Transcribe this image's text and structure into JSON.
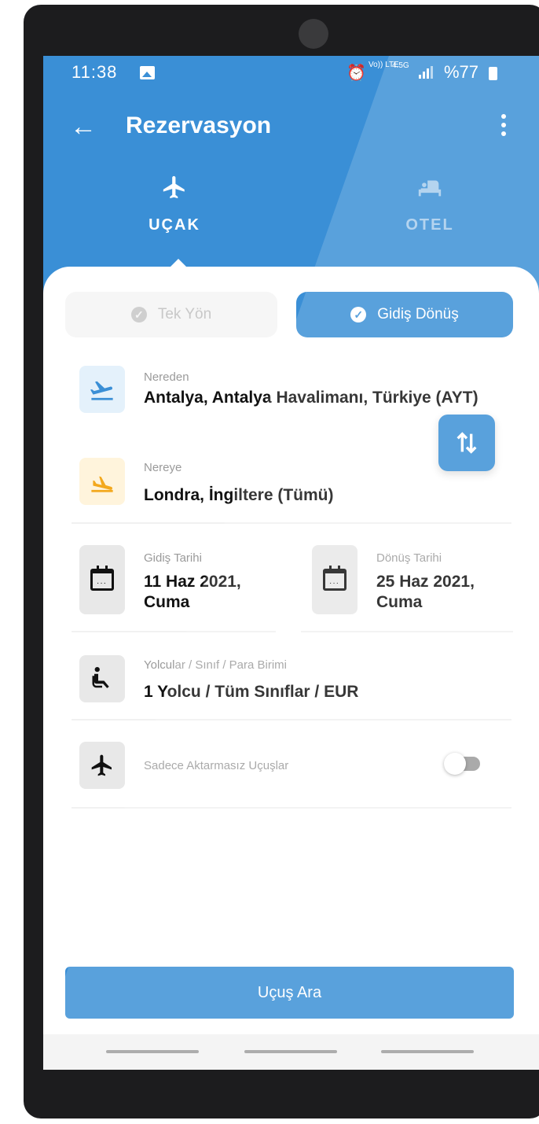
{
  "status_bar": {
    "time": "11:38",
    "network_top": "Vo)) LTE",
    "network_mid": "4.5G",
    "battery": "%77"
  },
  "toolbar": {
    "back_icon": "arrow-left-icon",
    "title": "Rezervasyon",
    "more_icon": "more-vertical-icon"
  },
  "tabs": [
    {
      "label": "UÇAK",
      "icon": "airplane-icon",
      "active": true
    },
    {
      "label": "OTEL",
      "icon": "bed-icon",
      "active": false
    }
  ],
  "trip_type": {
    "one_way": "Tek Yön",
    "round_trip": "Gidiş Dönüş",
    "selected": "round_trip"
  },
  "from": {
    "label": "Nereden",
    "value": "Antalya, Antalya Havalimanı, Türkiye (AYT)",
    "icon": "takeoff-icon"
  },
  "to": {
    "label": "Nereye",
    "value": "Londra, İngiltere (Tümü)",
    "icon": "landing-icon"
  },
  "swap_icon": "swap-vertical-icon",
  "departure": {
    "label": "Gidiş Tarihi",
    "date": "11 Haz 2021,",
    "day": "Cuma",
    "icon": "calendar-icon"
  },
  "return": {
    "label": "Dönüş Tarihi",
    "date": "25 Haz 2021,",
    "day": "Cuma",
    "icon": "calendar-icon"
  },
  "passengers": {
    "label": "Yolcular / Sınıf / Para Birimi",
    "value": "1 Yolcu / Tüm Sınıflar / EUR",
    "icon": "seat-icon"
  },
  "direct_only": {
    "label": "Sadece Aktarmasız Uçuşlar",
    "enabled": false,
    "icon": "airplane-icon"
  },
  "search_button": "Uçuş Ara",
  "colors": {
    "brand": "#3a8fd6",
    "takeoff_bg": "#e4f1fb",
    "landing_bg": "#fff4dc",
    "landing_icon": "#f3a81d"
  }
}
